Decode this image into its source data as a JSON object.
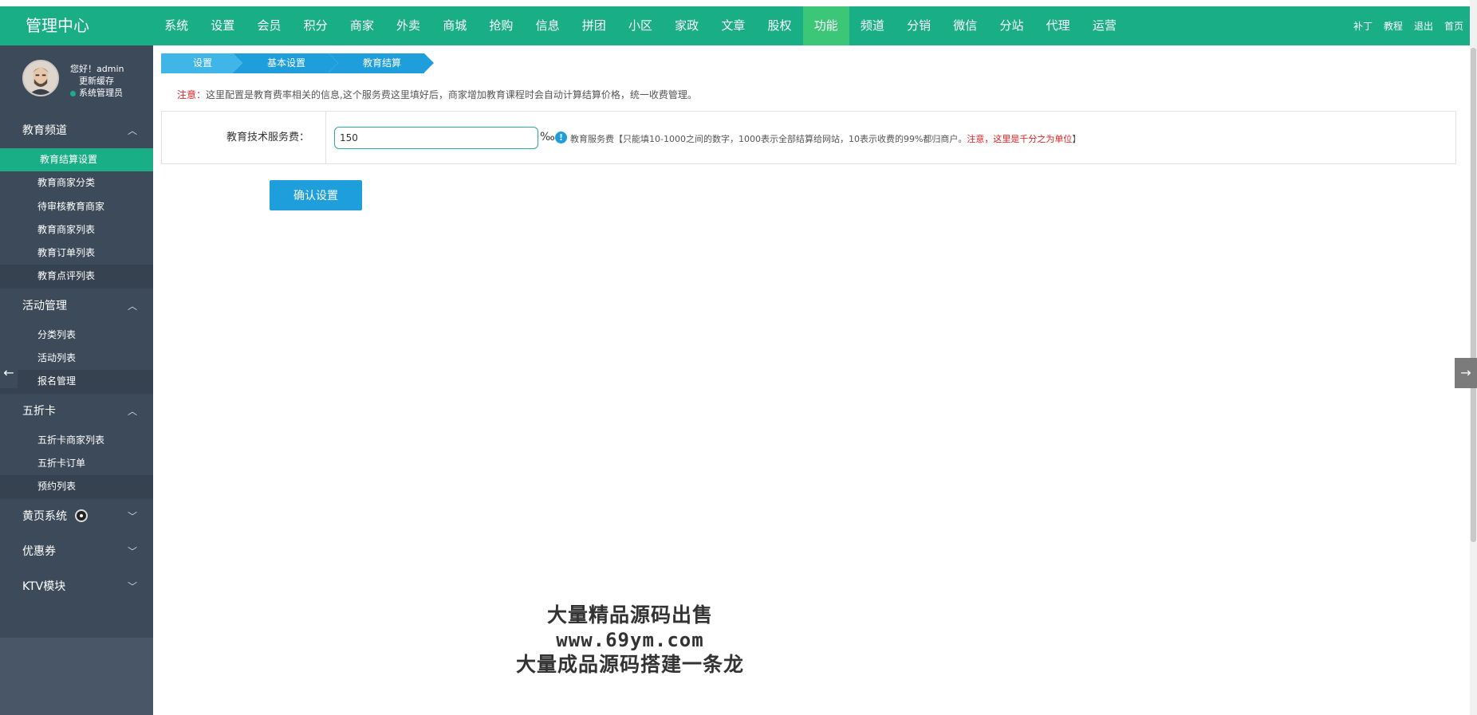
{
  "app": {
    "title": "管理中心"
  },
  "nav": {
    "items": [
      "系统",
      "设置",
      "会员",
      "积分",
      "商家",
      "外卖",
      "商城",
      "抢购",
      "信息",
      "拼团",
      "小区",
      "家政",
      "文章",
      "股权",
      "功能",
      "频道",
      "分销",
      "微信",
      "分站",
      "代理",
      "运营"
    ],
    "active": "功能",
    "right_links": [
      "补丁",
      "教程",
      "退出",
      "首页"
    ]
  },
  "user": {
    "greeting": "您好！admin",
    "refresh": "更新缓存",
    "role": "系统管理员"
  },
  "sidebar": {
    "groups": [
      {
        "title": "教育频道",
        "items": [
          "教育结算设置",
          "教育商家分类",
          "待审核教育商家",
          "教育商家列表",
          "教育订单列表",
          "教育点评列表"
        ]
      },
      {
        "title": "活动管理",
        "items": [
          "分类列表",
          "活动列表",
          "报名管理"
        ]
      },
      {
        "title": "五折卡",
        "items": [
          "五折卡商家列表",
          "五折卡订单",
          "预约列表"
        ]
      },
      {
        "title": "黄页系统"
      },
      {
        "title": "优惠券"
      },
      {
        "title": "KTV模块"
      }
    ]
  },
  "breadcrumb": [
    "设置",
    "基本设置",
    "教育结算"
  ],
  "notice": {
    "label": "注意：",
    "text": "这里配置是教育费率相关的信息,这个服务费这里填好后，商家增加教育课程时会自动计算结算价格，统一收费管理。"
  },
  "form": {
    "label": "教育技术服务费：",
    "value": "150",
    "unit": "‰",
    "help_prefix": "教育服务费【只能填10-1000之间的数字，1000表示全部结算给网站，10表示收费的99%都归商户。",
    "help_warn": "注意，这里是千分之为单位",
    "help_suffix": "】",
    "submit": "确认设置"
  },
  "watermark": {
    "line1": "大量精品源码出售",
    "line2": "www.69ym.com",
    "line3": "大量成品源码搭建一条龙"
  },
  "colors": {
    "brand": "#1aae87",
    "nav_active": "#3cc678",
    "sidebar": "#3d4a5a",
    "accent_blue": "#1e9fdb",
    "warn": "#e02020"
  }
}
